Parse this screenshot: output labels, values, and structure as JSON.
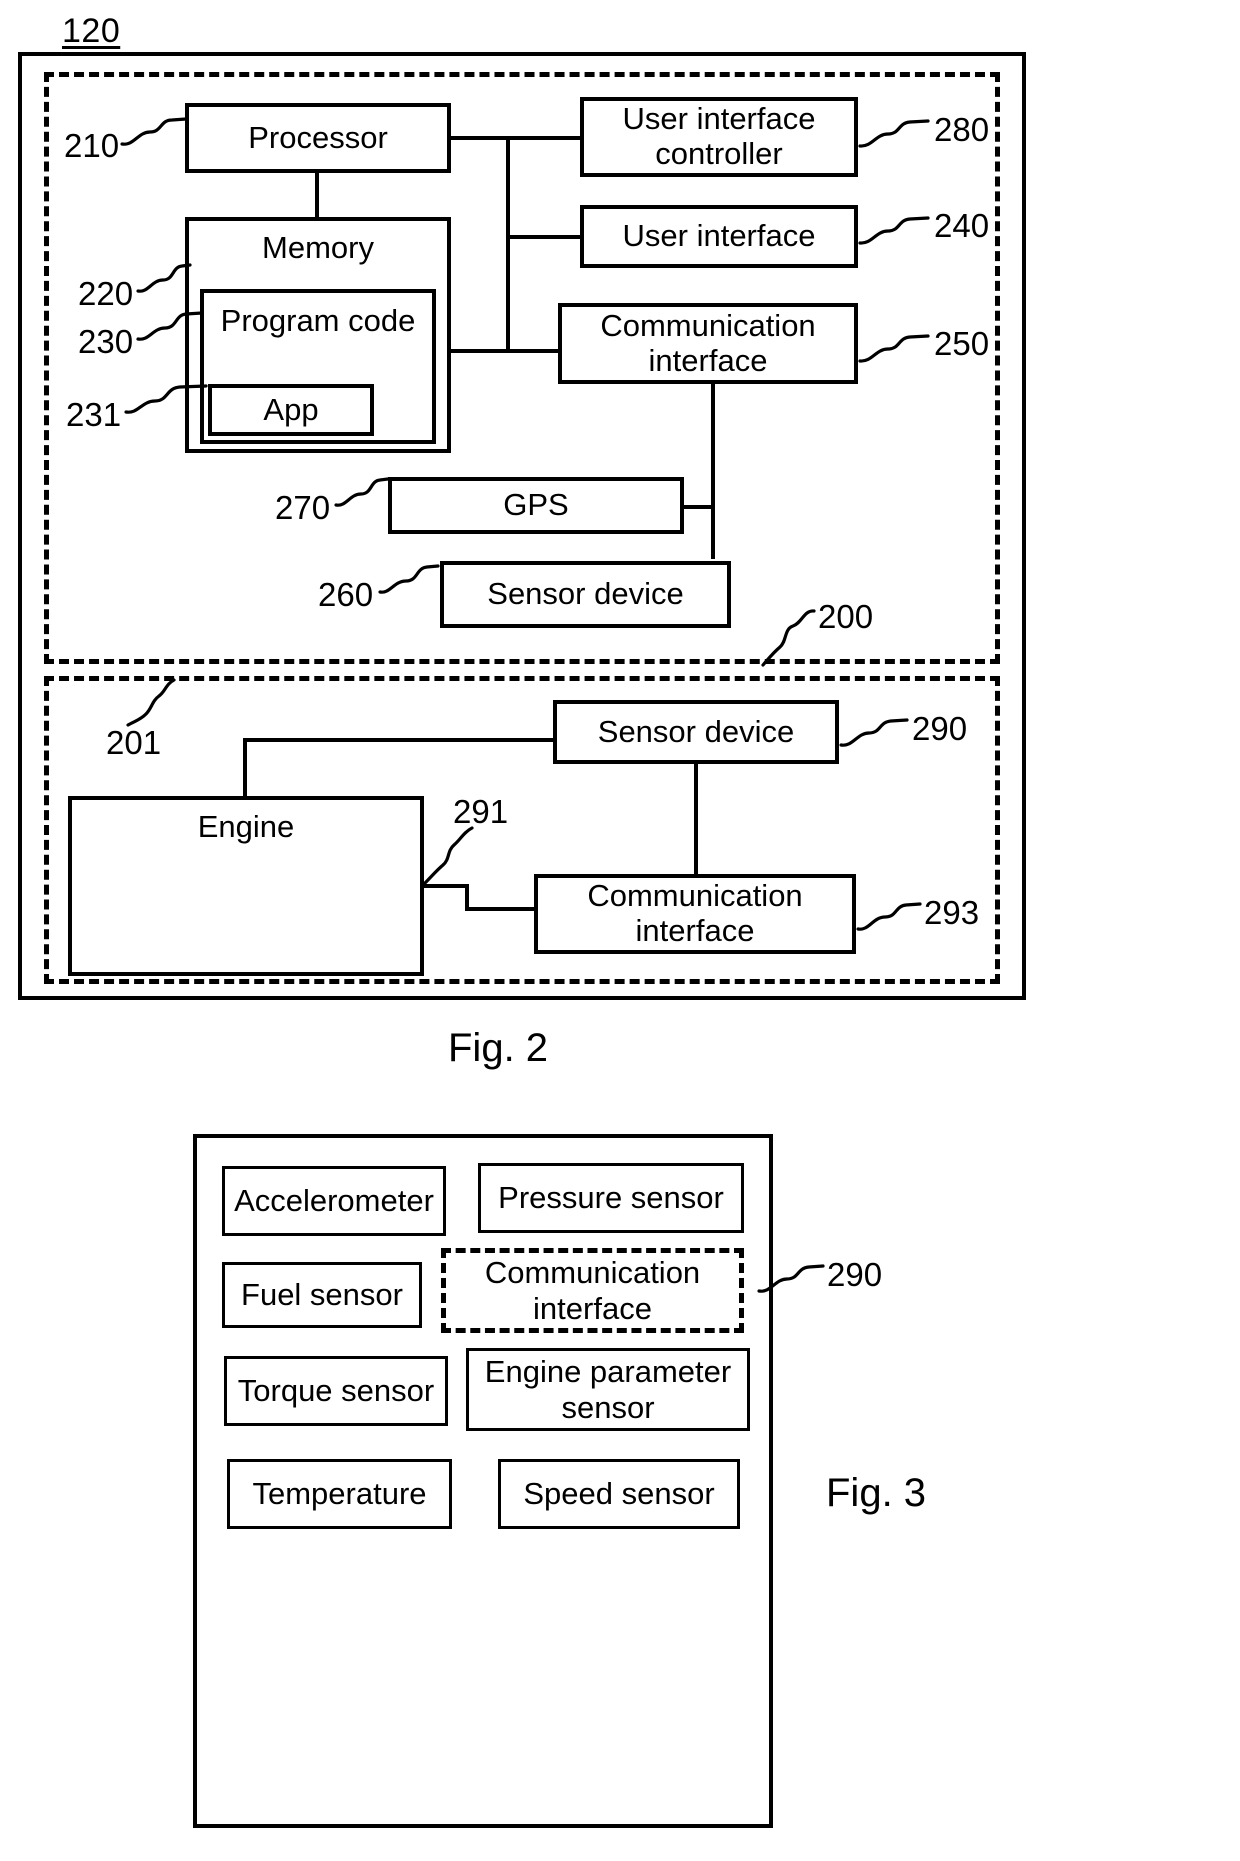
{
  "figure_120_label": "120",
  "fig2": {
    "caption": "Fig. 2",
    "outer_ref": "120",
    "refs": {
      "r210": "210",
      "r220": "220",
      "r230": "230",
      "r231": "231",
      "r270": "270",
      "r260": "260",
      "r280": "280",
      "r240": "240",
      "r250": "250",
      "r200": "200",
      "r201": "201",
      "r290": "290",
      "r291": "291",
      "r293": "293"
    },
    "blocks": {
      "processor": "Processor",
      "memory": "Memory",
      "program_code": "Program code",
      "app": "App",
      "gps": "GPS",
      "sensor_device_260": "Sensor device",
      "ui_controller": "User interface controller",
      "user_interface": "User interface",
      "comm_interface_250": "Communication interface",
      "sensor_device_290": "Sensor device",
      "engine": "Engine",
      "comm_interface_293": "Communication interface"
    }
  },
  "fig3": {
    "caption": "Fig. 3",
    "ref_290": "290",
    "items": [
      {
        "label": "Accelerometer",
        "style": "solid"
      },
      {
        "label": "Pressure sensor",
        "style": "solid"
      },
      {
        "label": "Fuel sensor",
        "style": "solid"
      },
      {
        "label": "Communication interface",
        "style": "dashed"
      },
      {
        "label": "Torque sensor",
        "style": "solid"
      },
      {
        "label": "Engine parameter sensor",
        "style": "solid"
      },
      {
        "label": "Temperature",
        "style": "solid"
      },
      {
        "label": "Speed sensor",
        "style": "solid"
      }
    ]
  }
}
